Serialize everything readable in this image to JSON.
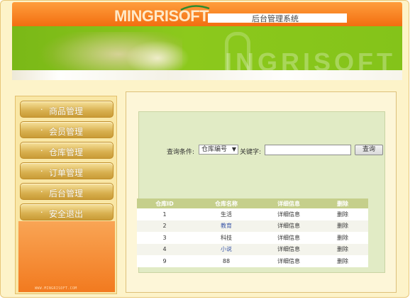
{
  "header": {
    "logo_text": "INGRISOFT",
    "logo_initial": "M",
    "system_title": "后台管理系统",
    "banner_watermark": "INGRISOFT"
  },
  "sidebar": {
    "items": [
      {
        "bullet": "·",
        "label": "商品管理"
      },
      {
        "bullet": "·",
        "label": "会员管理"
      },
      {
        "bullet": "·",
        "label": "仓库管理"
      },
      {
        "bullet": "·",
        "label": "订单管理"
      },
      {
        "bullet": "·",
        "label": "后台管理"
      },
      {
        "bullet": "·",
        "label": "安全退出"
      }
    ],
    "footer_url": "WWW.MINGRISOFT.COM"
  },
  "search": {
    "condition_label": "查询条件:",
    "condition_value": "仓库编号",
    "keyword_label": "关键字:",
    "keyword_value": "",
    "query_button": "查询"
  },
  "table": {
    "headers": [
      "仓库ID",
      "仓库名称",
      "详细信息",
      "删除"
    ],
    "rows": [
      {
        "id": "1",
        "name": "生活",
        "detail": "详细信息",
        "delete": "删除"
      },
      {
        "id": "2",
        "name": "教育",
        "detail": "详细信息",
        "delete": "删除"
      },
      {
        "id": "3",
        "name": "科技",
        "detail": "详细信息",
        "delete": "删除"
      },
      {
        "id": "4",
        "name": "小说",
        "detail": "详细信息",
        "delete": "删除"
      },
      {
        "id": "9",
        "name": "88",
        "detail": "详细信息",
        "delete": "删除"
      }
    ]
  },
  "colors": {
    "header_orange": "#f26e10",
    "banner_green": "#84c31a",
    "sidebar_gold": "#d8b050",
    "panel_green": "#e1ebc5",
    "table_header": "#c5cf8b"
  }
}
